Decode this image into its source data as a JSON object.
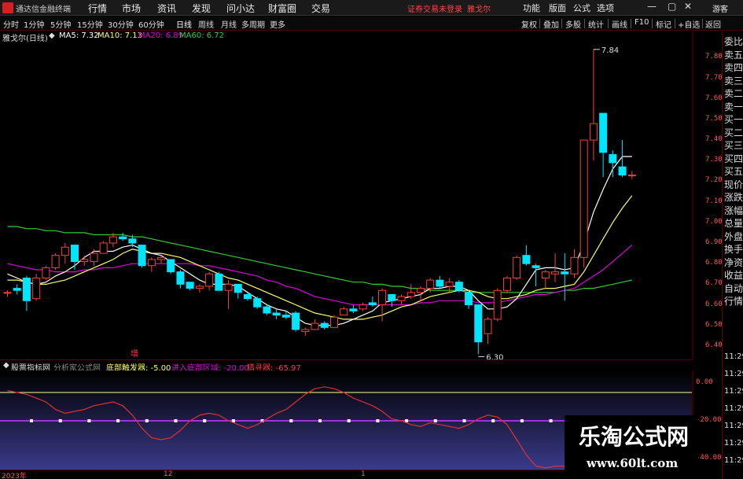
{
  "titlebar": {
    "app_title": "通达信金融终端",
    "menus": [
      "行情",
      "市场",
      "资讯",
      "发现",
      "问小达",
      "财富圈",
      "交易"
    ],
    "login_notice": "证券交易未登录",
    "stock_name": "雅戈尔",
    "right_buttons": [
      "功能",
      "版面",
      "公式",
      "选项"
    ],
    "guest": "游客"
  },
  "period_bar": {
    "periods": [
      "分时",
      "1分钟",
      "5分钟",
      "15分钟",
      "30分钟",
      "60分钟",
      "日线",
      "周线",
      "月线",
      "多周期",
      "更多"
    ],
    "active": "日线",
    "tools": [
      "复权",
      "叠加",
      "多股",
      "统计",
      "画线",
      "F10",
      "标记",
      "+自选",
      "返回"
    ]
  },
  "chart_header": {
    "name": "雅戈尔(日线)",
    "ma5": "MA5: 7.32",
    "ma10": "MA10: 7.13",
    "ma20": "MA20: 6.89",
    "ma60": "MA60: 6.72"
  },
  "right_col": {
    "items": [
      "委比",
      "卖五",
      "卖四",
      "卖三",
      "卖二",
      "卖一",
      "买一",
      "买二",
      "买三",
      "买四",
      "买五",
      "现价",
      "涨跌",
      "涨幅",
      "总量",
      "外盘",
      "换手",
      "净资",
      "收益",
      "自动",
      "行情"
    ],
    "times": [
      "11:29",
      "11:29",
      "11:29",
      "11:29",
      "11:29",
      "11:29",
      "11:29"
    ]
  },
  "price_axis": [
    "7.80",
    "7.70",
    "7.60",
    "7.50",
    "7.40",
    "7.30",
    "7.20",
    "7.10",
    "7.00",
    "6.90",
    "6.80",
    "6.70",
    "6.60",
    "6.50",
    "6.40"
  ],
  "annotations": {
    "high": "7.84",
    "low": "6.30",
    "zeng": "增"
  },
  "indicator": {
    "name": "股票指标网",
    "source": "分析家公式网",
    "lbl1": "底部触发器: -5.00",
    "lbl2": "进入底部区域: -20.00",
    "lbl3": "猎寻器: -65.97",
    "ticks": [
      "0.00",
      "-20.00",
      "-40.00"
    ]
  },
  "date_axis": [
    "2023年",
    "12",
    "1"
  ],
  "watermark": {
    "cn": "乐淘公式网",
    "url": "www.60lt.com"
  },
  "colors": {
    "up": "#ff3c3c",
    "down": "#00e5ff",
    "ma5": "#ffffff",
    "ma10": "#ffff66",
    "ma20": "#e000e0",
    "ma60": "#33cc33"
  },
  "chart_data": {
    "type": "candlestick",
    "ylim": [
      6.35,
      7.87
    ],
    "candles": [
      [
        6.66,
        6.67,
        6.64,
        6.66
      ],
      [
        6.68,
        6.7,
        6.65,
        6.67
      ],
      [
        6.73,
        6.74,
        6.57,
        6.62
      ],
      [
        6.63,
        6.75,
        6.62,
        6.73
      ],
      [
        6.73,
        6.79,
        6.72,
        6.78
      ],
      [
        6.78,
        6.85,
        6.77,
        6.84
      ],
      [
        6.84,
        6.9,
        6.8,
        6.88
      ],
      [
        6.89,
        6.89,
        6.77,
        6.81
      ],
      [
        6.81,
        6.84,
        6.79,
        6.82
      ],
      [
        6.81,
        6.87,
        6.79,
        6.85
      ],
      [
        6.85,
        6.91,
        6.85,
        6.9
      ],
      [
        6.9,
        6.95,
        6.88,
        6.93
      ],
      [
        6.93,
        6.95,
        6.91,
        6.92
      ],
      [
        6.92,
        6.94,
        6.88,
        6.9
      ],
      [
        6.89,
        6.89,
        6.78,
        6.79
      ],
      [
        6.79,
        6.83,
        6.76,
        6.82
      ],
      [
        6.82,
        6.84,
        6.8,
        6.83
      ],
      [
        6.82,
        6.82,
        6.75,
        6.76
      ],
      [
        6.76,
        6.77,
        6.68,
        6.7
      ],
      [
        6.71,
        6.71,
        6.67,
        6.68
      ],
      [
        6.68,
        6.7,
        6.66,
        6.69
      ],
      [
        6.69,
        6.76,
        6.67,
        6.75
      ],
      [
        6.75,
        6.76,
        6.67,
        6.67
      ],
      [
        6.67,
        6.72,
        6.58,
        6.7
      ],
      [
        6.7,
        6.7,
        6.63,
        6.66
      ],
      [
        6.65,
        6.66,
        6.62,
        6.63
      ],
      [
        6.63,
        6.64,
        6.58,
        6.59
      ],
      [
        6.59,
        6.6,
        6.55,
        6.56
      ],
      [
        6.56,
        6.58,
        6.53,
        6.55
      ],
      [
        6.55,
        6.57,
        6.53,
        6.54
      ],
      [
        6.56,
        6.57,
        6.47,
        6.48
      ],
      [
        6.47,
        6.49,
        6.45,
        6.48
      ],
      [
        6.48,
        6.53,
        6.48,
        6.51
      ],
      [
        6.51,
        6.52,
        6.48,
        6.49
      ],
      [
        6.49,
        6.55,
        6.49,
        6.54
      ],
      [
        6.55,
        6.59,
        6.55,
        6.58
      ],
      [
        6.58,
        6.6,
        6.56,
        6.57
      ],
      [
        6.58,
        6.61,
        6.57,
        6.6
      ],
      [
        6.61,
        6.64,
        6.59,
        6.6
      ],
      [
        6.6,
        6.68,
        6.52,
        6.67
      ],
      [
        6.65,
        6.65,
        6.59,
        6.62
      ],
      [
        6.62,
        6.65,
        6.6,
        6.64
      ],
      [
        6.64,
        6.7,
        6.63,
        6.66
      ],
      [
        6.66,
        6.69,
        6.62,
        6.68
      ],
      [
        6.68,
        6.73,
        6.66,
        6.72
      ],
      [
        6.72,
        6.74,
        6.68,
        6.69
      ],
      [
        6.69,
        6.73,
        6.66,
        6.71
      ],
      [
        6.71,
        6.72,
        6.66,
        6.67
      ],
      [
        6.66,
        6.67,
        6.58,
        6.6
      ],
      [
        6.6,
        6.6,
        6.36,
        6.42
      ],
      [
        6.46,
        6.54,
        6.41,
        6.53
      ],
      [
        6.53,
        6.68,
        6.52,
        6.67
      ],
      [
        6.67,
        6.74,
        6.66,
        6.73
      ],
      [
        6.73,
        6.84,
        6.72,
        6.83
      ],
      [
        6.84,
        6.89,
        6.79,
        6.8
      ],
      [
        6.79,
        6.8,
        6.69,
        6.78
      ],
      [
        6.73,
        6.77,
        6.68,
        6.76
      ],
      [
        6.75,
        6.85,
        6.71,
        6.76
      ],
      [
        6.76,
        6.85,
        6.62,
        6.75
      ],
      [
        6.75,
        6.87,
        6.73,
        6.83
      ],
      [
        6.83,
        7.4,
        6.78,
        7.4
      ],
      [
        7.4,
        7.84,
        7.3,
        7.48
      ],
      [
        7.53,
        7.53,
        7.22,
        7.34
      ],
      [
        7.33,
        7.35,
        7.22,
        7.29
      ],
      [
        7.27,
        7.4,
        7.22,
        7.23
      ],
      [
        7.23,
        7.25,
        7.21,
        7.23
      ]
    ],
    "ma": {
      "ma5": [
        6.75,
        6.73,
        6.71,
        6.7,
        6.71,
        6.74,
        6.76,
        6.79,
        6.83,
        6.86,
        6.86,
        6.86,
        6.88,
        6.89,
        6.87,
        6.85,
        6.84,
        6.81,
        6.78,
        6.75,
        6.72,
        6.7,
        6.7,
        6.7,
        6.69,
        6.66,
        6.63,
        6.6,
        6.58,
        6.57,
        6.54,
        6.51,
        6.5,
        6.5,
        6.5,
        6.51,
        6.53,
        6.55,
        6.57,
        6.61,
        6.62,
        6.63,
        6.64,
        6.65,
        6.68,
        6.68,
        6.69,
        6.69,
        6.67,
        6.62,
        6.58,
        6.58,
        6.59,
        6.63,
        6.7,
        6.77,
        6.78,
        6.78,
        6.77,
        6.78,
        6.9,
        7.05,
        7.16,
        7.26,
        7.32,
        7.32
      ],
      "ma10": [
        6.72,
        6.72,
        6.71,
        6.7,
        6.7,
        6.71,
        6.72,
        6.74,
        6.76,
        6.78,
        6.8,
        6.82,
        6.85,
        6.87,
        6.86,
        6.85,
        6.85,
        6.84,
        6.83,
        6.81,
        6.79,
        6.77,
        6.75,
        6.73,
        6.72,
        6.7,
        6.68,
        6.66,
        6.64,
        6.62,
        6.6,
        6.58,
        6.56,
        6.55,
        6.54,
        6.53,
        6.53,
        6.53,
        6.54,
        6.55,
        6.57,
        6.59,
        6.6,
        6.62,
        6.64,
        6.65,
        6.66,
        6.67,
        6.67,
        6.66,
        6.64,
        6.63,
        6.63,
        6.64,
        6.65,
        6.67,
        6.68,
        6.68,
        6.69,
        6.7,
        6.76,
        6.84,
        6.92,
        7.0,
        7.07,
        7.13
      ],
      "ma20": [
        6.8,
        6.79,
        6.78,
        6.77,
        6.77,
        6.76,
        6.76,
        6.76,
        6.77,
        6.77,
        6.78,
        6.78,
        6.79,
        6.8,
        6.8,
        6.8,
        6.8,
        6.8,
        6.8,
        6.8,
        6.79,
        6.79,
        6.78,
        6.77,
        6.76,
        6.75,
        6.74,
        6.72,
        6.71,
        6.69,
        6.68,
        6.66,
        6.64,
        6.63,
        6.62,
        6.61,
        6.6,
        6.6,
        6.6,
        6.6,
        6.6,
        6.6,
        6.6,
        6.61,
        6.61,
        6.62,
        6.62,
        6.62,
        6.62,
        6.61,
        6.61,
        6.61,
        6.62,
        6.63,
        6.64,
        6.65,
        6.65,
        6.66,
        6.67,
        6.68,
        6.71,
        6.74,
        6.77,
        6.81,
        6.85,
        6.89
      ],
      "ma60": [
        6.98,
        6.98,
        6.97,
        6.97,
        6.96,
        6.96,
        6.95,
        6.95,
        6.95,
        6.94,
        6.94,
        6.94,
        6.94,
        6.93,
        6.93,
        6.92,
        6.91,
        6.9,
        6.89,
        6.88,
        6.87,
        6.86,
        6.85,
        6.84,
        6.83,
        6.82,
        6.81,
        6.8,
        6.79,
        6.78,
        6.77,
        6.76,
        6.75,
        6.74,
        6.73,
        6.72,
        6.71,
        6.71,
        6.7,
        6.7,
        6.69,
        6.69,
        6.68,
        6.68,
        6.67,
        6.67,
        6.67,
        6.67,
        6.66,
        6.66,
        6.66,
        6.66,
        6.66,
        6.66,
        6.66,
        6.66,
        6.66,
        6.66,
        6.67,
        6.67,
        6.68,
        6.68,
        6.69,
        6.7,
        6.71,
        6.72
      ]
    },
    "indicator": {
      "ylim": [
        -45,
        5
      ],
      "hunter": [
        -4,
        -5,
        -6,
        -8,
        -10,
        -14,
        -16,
        -15,
        -14,
        -12,
        -11,
        -10,
        -12,
        -17,
        -24,
        -29,
        -30,
        -29,
        -25,
        -20,
        -17,
        -16,
        -17,
        -20,
        -22,
        -24,
        -22,
        -19,
        -16,
        -14,
        -10,
        -6,
        -3,
        -2,
        -3,
        -5,
        -8,
        -10,
        -12,
        -15,
        -19,
        -20,
        -22,
        -23,
        -21,
        -22,
        -23,
        -24,
        -22,
        -19,
        -17,
        -18,
        -22,
        -30,
        -38,
        -44,
        -45,
        -44,
        -44,
        -45,
        -45,
        -44,
        -44,
        -45,
        -45,
        -45
      ],
      "trigger": -5.0,
      "bottom": -20.0
    }
  }
}
